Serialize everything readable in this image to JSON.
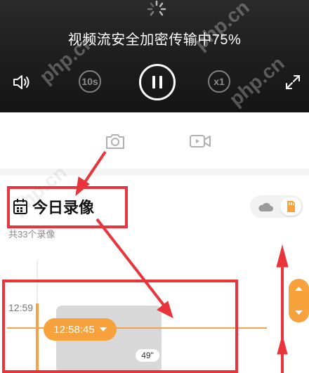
{
  "player": {
    "status_text": "视频流安全加密传输中75%",
    "rewind_label": "10s",
    "speed_label": "x1"
  },
  "recordings": {
    "title": "今日录像",
    "count_text": "共33个录像",
    "time_label": "12:59",
    "current_time": "12:58:45",
    "duration": "49\""
  },
  "watermark": "php.cn",
  "colors": {
    "accent": "#f7a23c",
    "annotation": "#e8343a"
  }
}
